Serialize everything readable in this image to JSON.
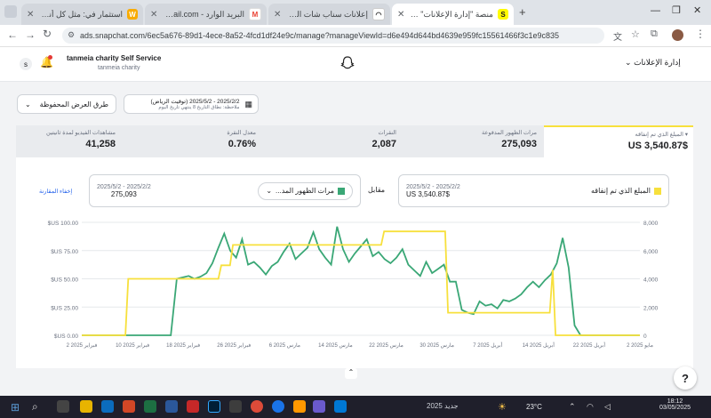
{
  "browser": {
    "tabs": [
      {
        "title": "استثمار في: مثل كل أنواع العدة",
        "favicon": "W",
        "color": "#f9ab00"
      },
      {
        "title": "البريد الوارد - Gmail@gmail.com",
        "favicon": "M",
        "color": "#ea4335"
      },
      {
        "title": "إعلانات سناب شات الوصول إلى",
        "favicon": "👻",
        "color": "#ffffff"
      },
      {
        "title": "منصة \"إدارة الإعلانات\" على سناب",
        "favicon": "S",
        "color": "#fffc00"
      }
    ],
    "new_tab": "+",
    "url": "ads.snapchat.com/6ec5a676-89d1-4ece-8a52-4fcd1df24e9c/manage?manageViewId=d6e494d644bd4639e959fc15561466f3c1e9c835"
  },
  "app": {
    "org_name": "tanmeia charity Self Service",
    "account_name": "tanmeia charity",
    "avatar_letter": "s",
    "manage_menu": "إدارة الإعلانات"
  },
  "toolbar": {
    "saved_views": "طرق العرض المحفوظة",
    "date_range": "2025/2/2 - 2025/5/2 (توقيت الرياض)",
    "date_note": "ملاحظة: نطاق التاريخ 8 ينتهي تاريخ اليوم"
  },
  "metrics": [
    {
      "label": "المبلغ الذي تم إنفاقه",
      "value": "$US 3,540.87"
    },
    {
      "label": "مرات الظهور المدفوعة",
      "value": "275,093"
    },
    {
      "label": "النقرات",
      "value": "2,087"
    },
    {
      "label": "معدل النقرة",
      "value": "0.76%"
    },
    {
      "label": "مشاهدات الفيديو لمدة ثانيتين",
      "value": "41,258"
    }
  ],
  "compare": {
    "primary_label": "المبلغ الذي تم إنفاقه",
    "primary_range": "2025/2/2 - 2025/5/2",
    "primary_value": "$US 3,540.87",
    "versus": "مقابل",
    "secondary_select": "مرات الظهور المد...",
    "secondary_range": "2025/2/2 - 2025/5/2",
    "secondary_value": "275,093",
    "hide_compare": "إخفاء المقارنة"
  },
  "chart_data": {
    "type": "line",
    "y_left_ticks": [
      "$US 100.00",
      "$US 75.00",
      "$US 50.00",
      "$US 25.00",
      "$US 0.00"
    ],
    "y_right_ticks": [
      "8,000",
      "6,000",
      "4,000",
      "2,000",
      "0"
    ],
    "x_ticks": [
      "2 فبراير 2025",
      "10 فبراير 2025",
      "18 فبراير 2025",
      "26 فبراير 2025",
      "6 مارس 2025",
      "14 مارس 2025",
      "22 مارس 2025",
      "30 مارس 2025",
      "7 أبريل 2025",
      "14 أبريل 2025",
      "22 أبريل 2025",
      "2 مايو 2025"
    ],
    "ylim_left": [
      0,
      100
    ],
    "ylim_right": [
      0,
      8000
    ],
    "series": [
      {
        "name": "المبلغ الذي تم إنفاقه",
        "color": "#f7e03c",
        "axis": "left",
        "values": [
          0,
          0,
          0,
          0,
          0,
          0,
          0,
          0,
          0,
          0,
          0,
          0,
          0,
          0,
          0,
          0,
          50,
          50,
          50,
          50,
          50,
          50,
          50,
          50,
          50,
          50,
          50,
          50,
          50,
          50,
          50,
          50,
          50,
          50,
          50,
          50,
          50,
          50,
          50,
          50,
          50,
          50,
          50,
          50,
          50,
          50,
          50,
          50,
          62,
          62,
          62,
          62,
          80,
          80,
          80,
          80,
          80,
          80,
          80,
          80,
          80,
          80,
          80,
          80,
          80,
          80,
          80,
          80,
          80,
          80,
          80,
          80,
          80,
          80,
          80,
          80,
          80,
          80,
          80,
          80,
          80,
          80,
          80,
          80,
          80,
          80,
          80,
          80,
          80,
          80,
          80,
          80,
          80,
          80,
          80,
          80,
          80,
          80,
          80,
          80,
          80,
          80,
          80,
          80,
          92,
          92,
          92,
          92,
          92,
          92,
          92,
          92,
          92,
          92,
          92,
          92,
          92,
          92,
          92,
          92,
          92,
          92,
          92,
          92,
          92,
          92,
          20,
          20,
          20,
          20,
          20,
          20,
          20,
          20,
          20,
          20,
          20,
          20,
          20,
          20,
          20,
          20,
          20,
          20,
          20,
          20,
          20,
          20,
          20,
          20,
          20,
          20,
          20,
          20,
          20,
          20,
          20,
          20,
          20,
          20,
          20,
          20,
          58,
          0,
          0,
          0,
          0,
          0,
          0,
          0,
          0,
          0,
          0,
          0,
          0,
          0,
          0,
          0,
          0,
          0,
          0,
          0,
          0,
          0,
          0,
          0,
          0,
          0,
          0,
          0,
          0,
          0,
          0
        ]
      },
      {
        "name": "مرات الظهور المدفوعة",
        "color": "#3aa776",
        "axis": "right",
        "values": [
          0,
          0,
          0,
          0,
          0,
          0,
          0,
          0,
          0,
          0,
          0,
          0,
          0,
          0,
          0,
          0,
          4000,
          4100,
          4200,
          4000,
          4150,
          4400,
          5100,
          6200,
          7200,
          6000,
          5500,
          6800,
          5000,
          5200,
          4800,
          4300,
          4900,
          5200,
          5900,
          6500,
          5400,
          5800,
          6200,
          7300,
          6100,
          5500,
          5000,
          7700,
          6100,
          5200,
          5800,
          6300,
          6800,
          5600,
          5900,
          5400,
          5100,
          5500,
          6100,
          5000,
          4600,
          4200,
          5200,
          4400,
          4700,
          5000,
          3800,
          3800,
          1800,
          1600,
          1500,
          2400,
          2100,
          2200,
          1900,
          2500,
          2400,
          2600,
          2900,
          3400,
          3800,
          3400,
          3900,
          4300,
          5100,
          6900,
          4800,
          700,
          0,
          0,
          0,
          0,
          0,
          0,
          0,
          0,
          0,
          0,
          0
        ]
      }
    ]
  },
  "taskbar": {
    "temperature": "23°C",
    "time": "18:12",
    "date": "03/05/2025",
    "search_text": "2025 جديد"
  }
}
